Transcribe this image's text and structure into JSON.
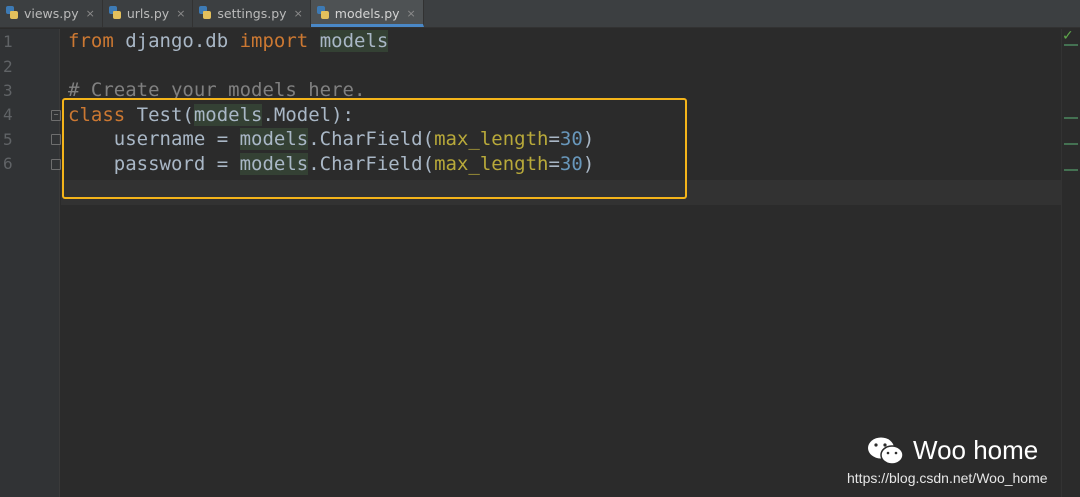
{
  "tabs": [
    {
      "label": "views.py",
      "active": false
    },
    {
      "label": "urls.py",
      "active": false
    },
    {
      "label": "settings.py",
      "active": false
    },
    {
      "label": "models.py",
      "active": true
    }
  ],
  "close_glyph": "×",
  "line_numbers": [
    "1",
    "2",
    "3",
    "4",
    "5",
    "6"
  ],
  "code": {
    "line1": {
      "kw_from": "from",
      "module": " django.db ",
      "kw_import": "import",
      "space": " ",
      "name": "models"
    },
    "line3": {
      "comment": "# Create your models here."
    },
    "line4": {
      "kw_class": "class",
      "rest1": " Test(",
      "ref": "models",
      "rest2": ".Model):"
    },
    "line5": {
      "indent": "    username = ",
      "ref": "models",
      "call": ".CharField(",
      "param": "max_length",
      "eq": "=",
      "num": "30",
      "close": ")"
    },
    "line6": {
      "indent": "    password = ",
      "ref": "models",
      "call": ".CharField(",
      "param": "max_length",
      "eq": "=",
      "num": "30",
      "close": ")"
    }
  },
  "inspection_status": "✓",
  "watermark": {
    "title": "Woo home",
    "url": "https://blog.csdn.net/Woo_home"
  },
  "colors": {
    "keyword": "#cc7832",
    "comment": "#808080",
    "number": "#6897bb",
    "annotation_box": "#f4b41a"
  }
}
